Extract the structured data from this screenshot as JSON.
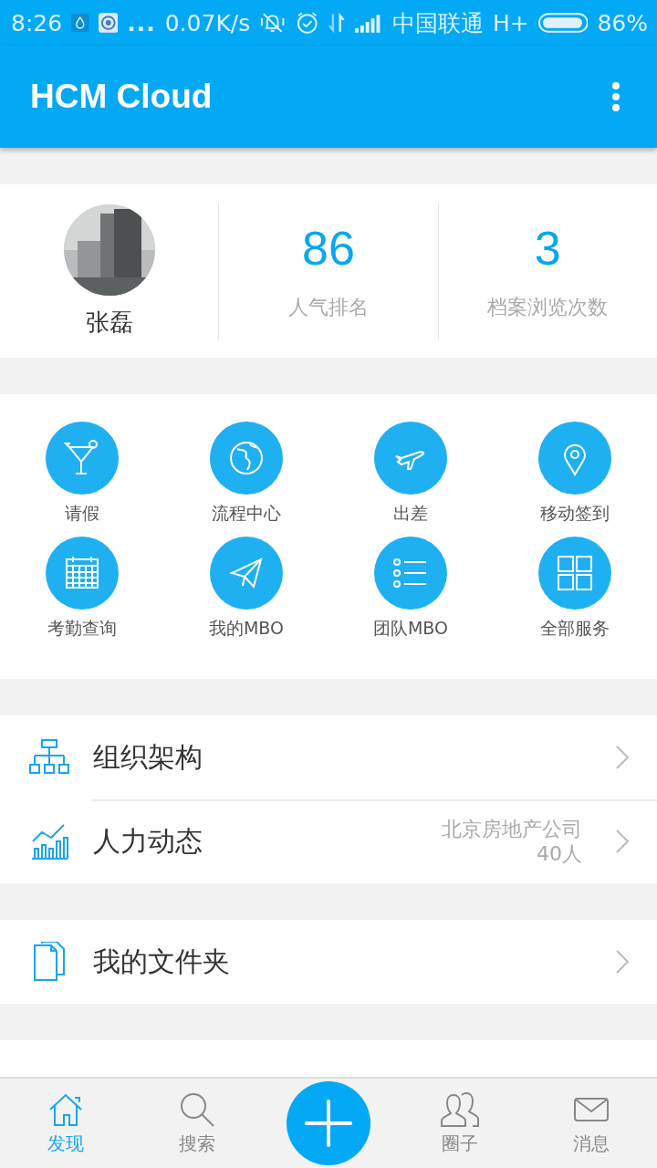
{
  "status_bar": {
    "time": "8:26",
    "more": "...",
    "network_speed": "0.07K/s",
    "carrier": "中国联通",
    "network_type": "H+",
    "battery_percent": "86%"
  },
  "app_bar": {
    "title": "HCM Cloud"
  },
  "profile": {
    "name": "张磊",
    "stats": [
      {
        "value": "86",
        "label": "人气排名"
      },
      {
        "value": "3",
        "label": "档案浏览次数"
      }
    ]
  },
  "services": [
    {
      "label": "请假"
    },
    {
      "label": "流程中心"
    },
    {
      "label": "出差"
    },
    {
      "label": "移动签到"
    },
    {
      "label": "考勤查询"
    },
    {
      "label": "我的MBO"
    },
    {
      "label": "团队MBO"
    },
    {
      "label": "全部服务"
    }
  ],
  "menu_sections": [
    [
      {
        "label": "组织架构"
      },
      {
        "label": "人力动态",
        "detail": [
          "北京房地产公司",
          "40人"
        ]
      }
    ],
    [
      {
        "label": "我的文件夹"
      }
    ]
  ],
  "bottom_nav": [
    {
      "label": "发现",
      "selected": true
    },
    {
      "label": "搜索",
      "selected": false
    },
    {
      "label": "圈子",
      "selected": false
    },
    {
      "label": "消息",
      "selected": false
    }
  ]
}
